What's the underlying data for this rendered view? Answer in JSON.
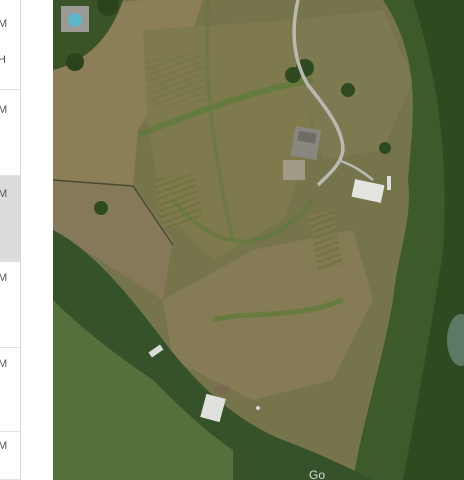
{
  "side_list": {
    "rows": [
      {
        "lines": [
          "M",
          "H"
        ]
      },
      {
        "lines": [
          "M"
        ]
      },
      {
        "lines": [
          "M"
        ],
        "selected": true
      },
      {
        "lines": [
          "M"
        ]
      },
      {
        "lines": [
          "M"
        ]
      },
      {
        "lines": [
          "M"
        ]
      }
    ]
  },
  "map": {
    "type": "satellite",
    "caption": "Go"
  },
  "colors": {
    "panel_bg": "#ffffff",
    "panel_selected": "#dcdcdc",
    "field": "#7a7a4a",
    "trees": "#2f4a22",
    "road": "#b9b9b0"
  }
}
